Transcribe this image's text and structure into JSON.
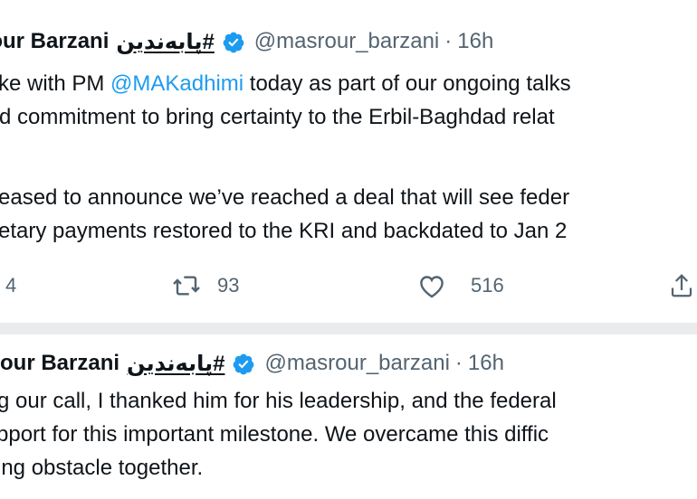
{
  "tweet1": {
    "author_name": "rour Barzani",
    "author_tag": "#پابەندین",
    "handle": "@masrour_barzani",
    "separator": "·",
    "time": "16h",
    "lines": [
      [
        "ke with PM ",
        "@MAKadhimi",
        " today as part of our ongoing talks"
      ],
      [
        "d commitment to bring certainty to the Erbil-Baghdad relat"
      ],
      [
        "eased to announce we’ve reached a deal that will see feder"
      ],
      [
        "etary payments restored to the KRI and backdated to Jan 2"
      ]
    ],
    "replies": "4",
    "retweets": "93",
    "likes": "516"
  },
  "tweet2": {
    "author_name": "our Barzani",
    "author_tag": "#پابەندین",
    "handle": "@masrour_barzani",
    "separator": "·",
    "time": "16h",
    "lines": [
      "g our call, I thanked him for his leadership, and the federal",
      "pport for this important milestone. We overcame this diffic",
      "ing obstacle together."
    ]
  },
  "colors": {
    "text": "#0f1419",
    "secondary": "#536471",
    "mention": "#1d9bf0",
    "verified": "#1d9bf0",
    "divider": "#e9ebec"
  },
  "icons": [
    "verified-badge-icon",
    "reply-icon",
    "retweet-icon",
    "like-icon",
    "share-icon"
  ]
}
